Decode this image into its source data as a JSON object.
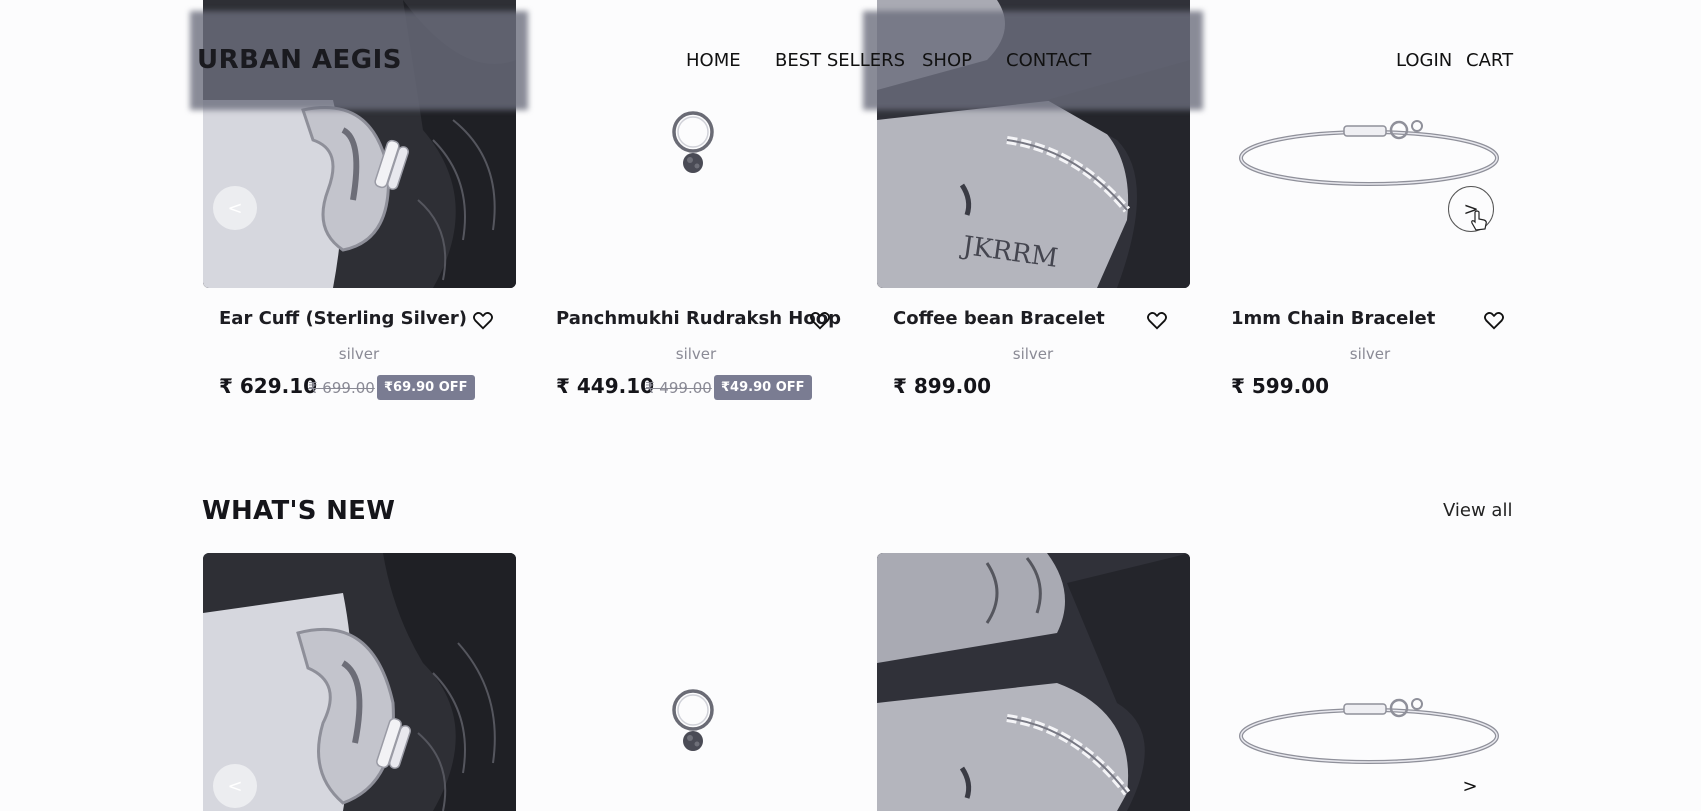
{
  "header": {
    "logo": "URBAN AEGIS",
    "nav": [
      "HOME",
      "BEST SELLERS",
      "SHOP",
      "CONTACT"
    ],
    "login": "LOGIN",
    "cart": "CART"
  },
  "carousel": {
    "prev_label": "<",
    "next_label": ">"
  },
  "best_sellers": {
    "products": [
      {
        "name": "Ear Cuff (Sterling Silver)",
        "color": "silver",
        "price": "₹ 629.10",
        "old_price": "₹ 699.00",
        "discount": "₹69.90 OFF"
      },
      {
        "name": "Panchmukhi Rudraksh Hoop",
        "color": "silver",
        "price": "₹ 449.10",
        "old_price": "₹ 499.00",
        "discount": "₹49.90 OFF"
      },
      {
        "name": "Coffee bean Bracelet",
        "color": "silver",
        "price": "₹ 899.00"
      },
      {
        "name": "1mm Chain Bracelet",
        "color": "silver",
        "price": "₹ 599.00"
      }
    ]
  },
  "whats_new": {
    "title": "WHAT'S NEW",
    "view_all": "View all"
  },
  "colors": {
    "background": "#fcfcfd",
    "badge": "#7a7c92",
    "muted_text": "#8a8a95"
  }
}
